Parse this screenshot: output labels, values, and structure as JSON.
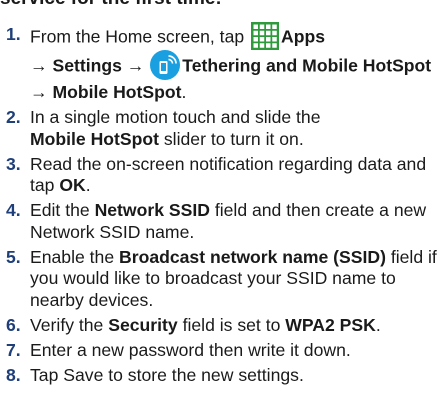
{
  "heading": "service for the first time:",
  "steps": [
    {
      "number": "1.",
      "p1": "From the Home screen, tap",
      "apps": "Apps",
      "arrow1": "→",
      "settings": "Settings",
      "arrow2": "→",
      "tethering": "Tethering and Mobile HotSpot",
      "arrow3": "→",
      "hotspot": "Mobile HotSpot",
      "end": "."
    },
    {
      "number": "2.",
      "p1": "In a single motion touch and slide the",
      "b1": "Mobile HotSpot",
      "p2": " slider to turn it on."
    },
    {
      "number": "3.",
      "p1": "Read the on-screen notification regarding data and tap ",
      "b1": "OK",
      "p2": "."
    },
    {
      "number": "4.",
      "p1": "Edit the ",
      "b1": "Network SSID",
      "p2": " field and then create a new Network SSID name."
    },
    {
      "number": "5.",
      "p1": "Enable the ",
      "b1": "Broadcast network name (SSID)",
      "p2": " field if you would like to broadcast your SSID name to nearby devices."
    },
    {
      "number": "6.",
      "p1": "Verify the ",
      "b1": "Security",
      "p2": " field is set to ",
      "b2": "WPA2 PSK",
      "p3": "."
    },
    {
      "number": "7.",
      "p1": "Enter a new password then write it down."
    },
    {
      "number": "8.",
      "p1": "Tap Save to store the new settings."
    }
  ],
  "icons": {
    "apps": "apps-grid-icon",
    "tethering": "tethering-hotspot-icon"
  },
  "colors": {
    "step_number": "#1f3f7a",
    "apps_icon": "#2f9a3c",
    "tethering_icon": "#1a9fe0"
  }
}
